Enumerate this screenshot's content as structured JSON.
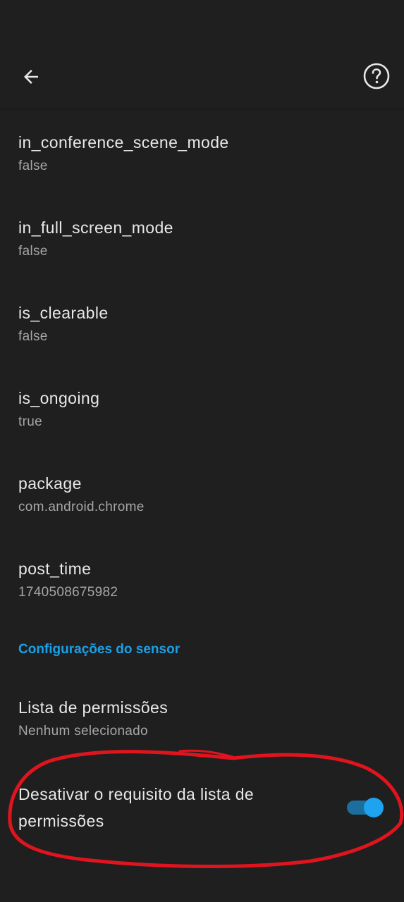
{
  "app_bar": {
    "back_icon": "arrow-back-icon",
    "help_icon": "help-circle-icon"
  },
  "items": [
    {
      "title": "in_conference_scene_mode",
      "value": "false"
    },
    {
      "title": "in_full_screen_mode",
      "value": "false"
    },
    {
      "title": "is_clearable",
      "value": "false"
    },
    {
      "title": "is_ongoing",
      "value": "true"
    },
    {
      "title": "package",
      "value": "com.android.chrome"
    },
    {
      "title": "post_time",
      "value": "1740508675982"
    }
  ],
  "sensor_section": {
    "header": "Configurações do sensor",
    "allowlist": {
      "title": "Lista de permissões",
      "value": "Nenhum selecionado"
    },
    "disable_requirement": {
      "label": "Desativar o requisito da lista de permissões",
      "enabled": true
    }
  },
  "colors": {
    "background": "#1f1f1f",
    "accent": "#1aa0e8",
    "annotation": "#e0141e"
  }
}
